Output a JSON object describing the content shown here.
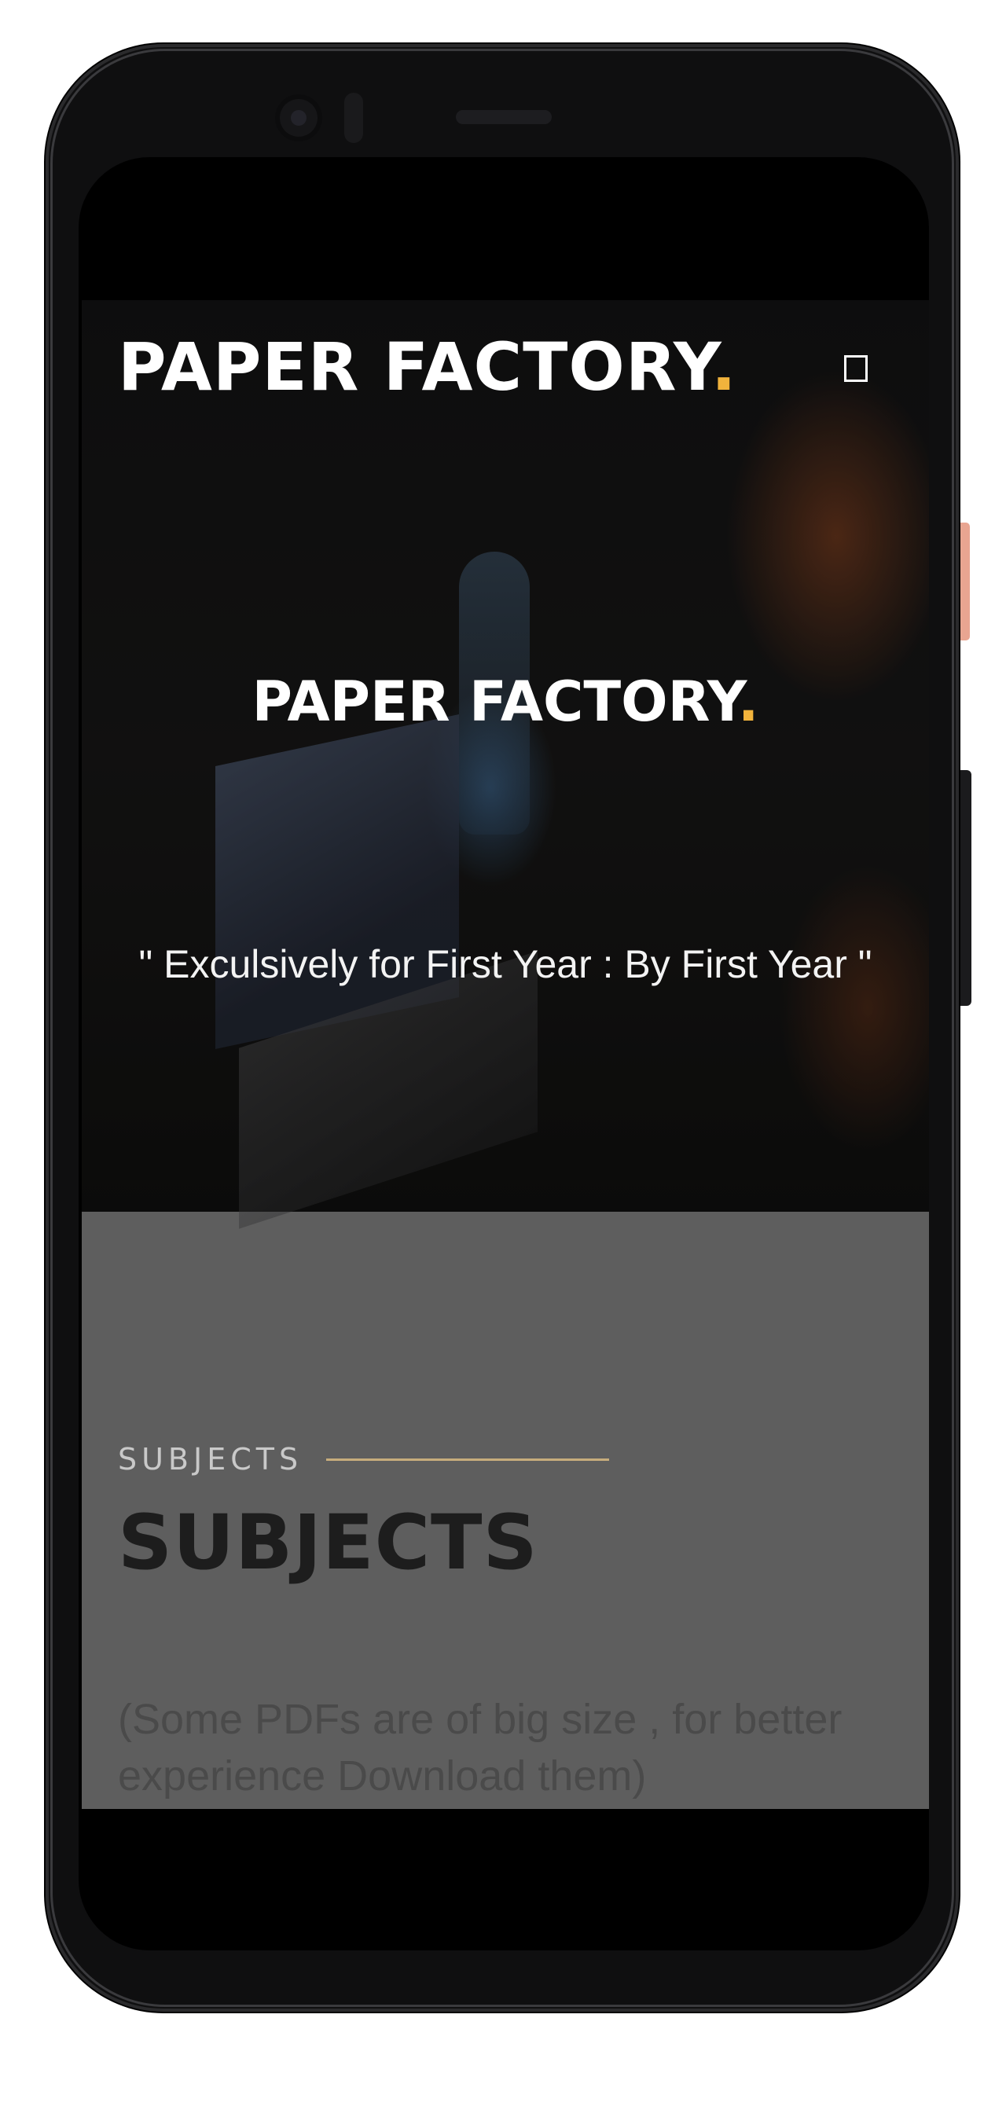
{
  "header": {
    "brand_text": "PAPER FACTORY",
    "brand_dot": ".",
    "menu_icon": "square-menu-icon"
  },
  "hero": {
    "title_text": "PAPER FACTORY",
    "title_dot": ".",
    "tagline": "\" Exculsively for First Year : By First Year \""
  },
  "subjects": {
    "label": "SUBJECTS",
    "heading": "SUBJECTS",
    "note": "(Some PDFs are of big size , for better experience Download them)"
  },
  "colors": {
    "accent": "#f1b33c",
    "section_line": "#c7ad7c",
    "section_bg": "#5e5e5e"
  }
}
